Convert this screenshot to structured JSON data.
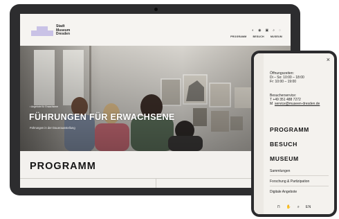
{
  "tablet": {
    "logo": {
      "line1": "Stadt",
      "line2": "Museum",
      "line3": "Dresden"
    },
    "nav": [
      "PROGRAMM",
      "BESUCH",
      "MUSEUM"
    ],
    "hero": {
      "kicker": "▪ Angebote für Erwachsene",
      "title": "FÜHRUNGEN FÜR ERWACHSENE",
      "subtitle": "Führungen in der Dauerausstellung"
    },
    "section_title": "PROGRAMM"
  },
  "phone": {
    "close": "×",
    "hours_label": "Öffnungszeiten:",
    "hours_1": "Di – So: 10:00 – 18:00",
    "hours_2": "Fr: 10:00 – 19:00",
    "service_label": "Besucherservice:",
    "phone_line": "T   +49 351 488 7272",
    "mail_prefix": "M",
    "mail": "service@museen-dresden.de",
    "nav": [
      "PROGRAMM",
      "BESUCH",
      "MUSEUM"
    ],
    "subnav": [
      "Sammlungen",
      "Forschung & Partizipation",
      "Digitale Angebote"
    ],
    "lang": "EN"
  },
  "colors": {
    "device": "#2d2d2f",
    "logo_purple": "#c9c2e6",
    "page_bg": "#f4f2ee"
  }
}
